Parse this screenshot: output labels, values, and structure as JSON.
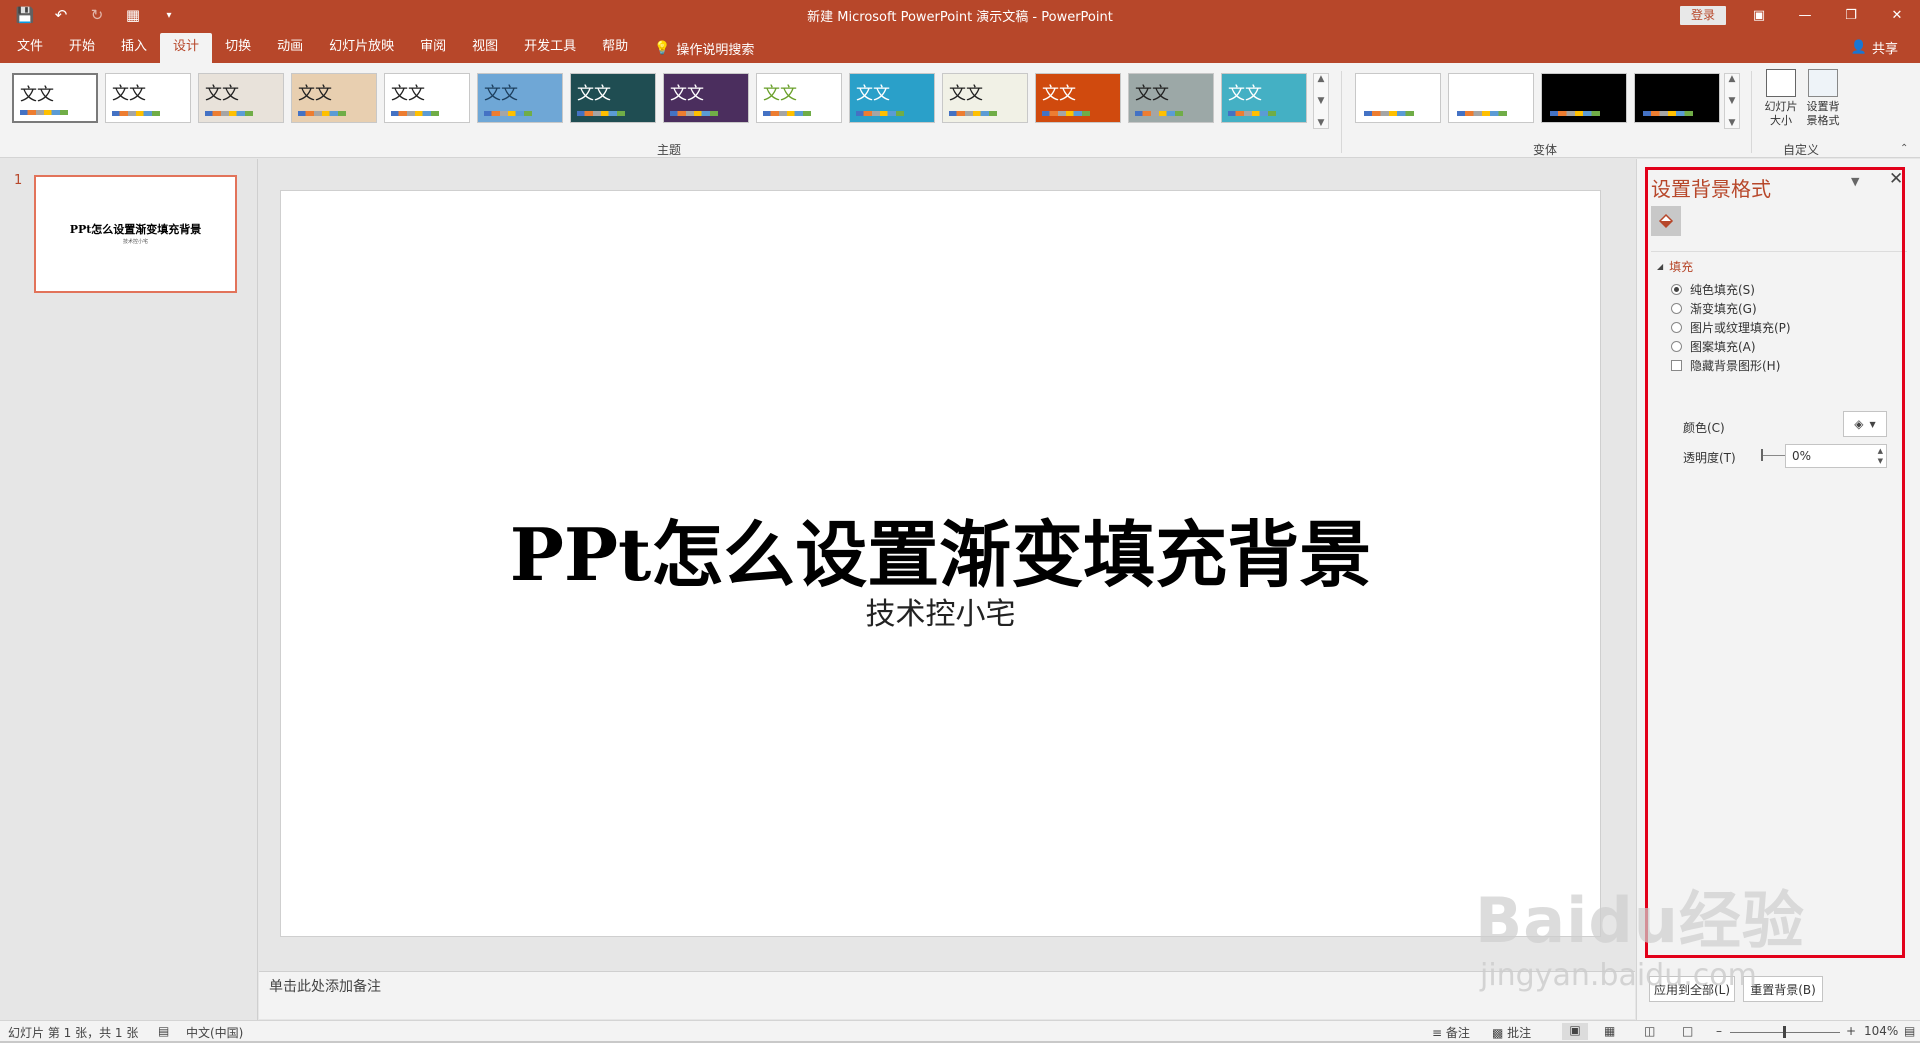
{
  "titlebar": {
    "doc_title": "新建 Microsoft PowerPoint 演示文稿  -  PowerPoint",
    "login": "登录",
    "qat_icons": [
      "save-icon",
      "undo-icon",
      "redo-icon",
      "start-slideshow-icon",
      "customize-qat-icon"
    ],
    "window_controls": [
      "ribbon-display-options-icon",
      "minimize-icon",
      "maximize-icon",
      "close-icon"
    ]
  },
  "menu": {
    "tabs": [
      "文件",
      "开始",
      "插入",
      "设计",
      "切换",
      "动画",
      "幻灯片放映",
      "审阅",
      "视图",
      "开发工具",
      "帮助"
    ],
    "active_tab": "设计",
    "tell_me": "操作说明搜索",
    "share": "共享"
  },
  "ribbon": {
    "themes_label": "主题",
    "variants_label": "变体",
    "customize_label": "自定义",
    "theme_thumb_text": "文文",
    "themes": [
      {
        "bg": "#ffffff",
        "fg": "#222222"
      },
      {
        "bg": "#ffffff",
        "fg": "#222222"
      },
      {
        "bg": "#e8e2da",
        "fg": "#222222"
      },
      {
        "bg": "#e8cfb0",
        "fg": "#222222"
      },
      {
        "bg": "#ffffff",
        "fg": "#222222"
      },
      {
        "bg": "#6fa7d6",
        "fg": "#1d3f5e"
      },
      {
        "bg": "#1f4d52",
        "fg": "#ffffff"
      },
      {
        "bg": "#4b2e5e",
        "fg": "#ffffff"
      },
      {
        "bg": "#ffffff",
        "fg": "#6aa02b"
      },
      {
        "bg": "#2aa0c9",
        "fg": "#ffffff"
      },
      {
        "bg": "#f1f1e6",
        "fg": "#222222"
      },
      {
        "bg": "#d04a0e",
        "fg": "#ffffff"
      },
      {
        "bg": "#9ca8a7",
        "fg": "#222222"
      },
      {
        "bg": "#44b0c4",
        "fg": "#ffffff"
      }
    ],
    "variants": [
      {
        "bg": "#ffffff"
      },
      {
        "bg": "#ffffff"
      },
      {
        "bg": "#000000"
      },
      {
        "bg": "#000000"
      }
    ],
    "slide_size": "幻灯片\n大小",
    "format_background": "设置背\n景格式"
  },
  "thumbnail_pane": {
    "slide_number": "1",
    "thumb_title": "PPt怎么设置渐变填充背景",
    "thumb_subtitle": "技术控小宅"
  },
  "slide": {
    "title": "PPt怎么设置渐变填充背景",
    "subtitle": "技术控小宅"
  },
  "notes": {
    "placeholder": "单击此处添加备注"
  },
  "format_pane": {
    "title": "设置背景格式",
    "section": "填充",
    "options": [
      {
        "label": "纯色填充(S)",
        "type": "radio",
        "checked": true
      },
      {
        "label": "渐变填充(G)",
        "type": "radio",
        "checked": false
      },
      {
        "label": "图片或纹理填充(P)",
        "type": "radio",
        "checked": false
      },
      {
        "label": "图案填充(A)",
        "type": "radio",
        "checked": false
      },
      {
        "label": "隐藏背景图形(H)",
        "type": "checkbox",
        "checked": false
      }
    ],
    "color_label": "颜色(C)",
    "transparency_label": "透明度(T)",
    "transparency_value": "0%",
    "apply_all": "应用到全部(L)",
    "reset": "重置背景(B)"
  },
  "watermark": {
    "logo": "Baidu经验",
    "url": "jingyan.baidu.com"
  },
  "statusbar": {
    "slide_info": "幻灯片 第 1 张，共 1 张",
    "language": "中文(中国)",
    "notes": "备注",
    "comments": "批注",
    "zoom": "104%"
  },
  "colors": {
    "accent": "#b7472a",
    "highlight": "#e2001a"
  }
}
